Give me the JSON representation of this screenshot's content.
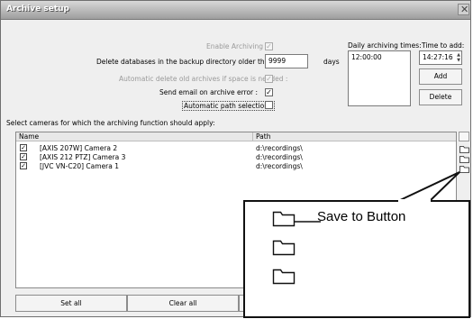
{
  "window": {
    "title": "Archive setup"
  },
  "settings": {
    "enable_archiving_label": "Enable Archiving :",
    "delete_older_label": "Delete databases in the backup directory older than :",
    "delete_older_value": "9999",
    "days_label": "days",
    "auto_delete_label": "Automatic delete old archives if space is needed :",
    "send_email_label": "Send email on archive error :",
    "auto_path_label": "Automatic path selection :"
  },
  "schedule": {
    "daily_label": "Daily archiving times:",
    "times": [
      "12:00:00"
    ],
    "time_to_add_label": "Time to add:",
    "time_to_add_value": "14:27:16",
    "add_button": "Add",
    "delete_button": "Delete"
  },
  "cameras": {
    "prompt": "Select cameras for which the archiving function should apply:",
    "columns": [
      "Name",
      "Path"
    ],
    "rows": [
      {
        "name": "[AXIS 207W] Camera 2",
        "path": "d:\\recordings\\",
        "checked": true
      },
      {
        "name": "[AXIS 212 PTZ] Camera 3",
        "path": "d:\\recordings\\",
        "checked": true
      },
      {
        "name": "[JVC VN-C20] Camera 1",
        "path": "d:\\recordings\\",
        "checked": true
      }
    ],
    "set_all_button": "Set all",
    "clear_all_button": "Clear all"
  },
  "callout": {
    "label": "Save to Button"
  },
  "icons": {
    "close": "close-icon",
    "folder": "folder-icon",
    "spinner": "spinner-icon"
  }
}
